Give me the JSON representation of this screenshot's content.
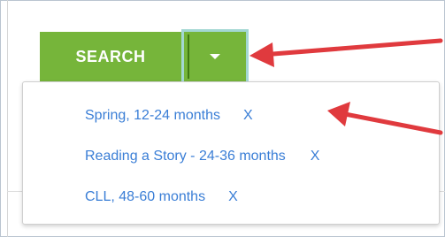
{
  "search": {
    "button_label": "SEARCH",
    "dropdown_toggle_icon": "caret-down-icon"
  },
  "saved_searches": [
    {
      "label": "Spring, 12-24 months",
      "remove_label": "X"
    },
    {
      "label": "Reading a Story - 24-36 months",
      "remove_label": "X"
    },
    {
      "label": "CLL, 48-60 months",
      "remove_label": "X"
    }
  ],
  "colors": {
    "button_green": "#76b53a",
    "toggle_focus_border": "#a3d7d3",
    "link_blue": "#3a7ed6",
    "annotation_red": "#e03a3e"
  },
  "annotations": {
    "icon": "red-arrow-icon"
  }
}
